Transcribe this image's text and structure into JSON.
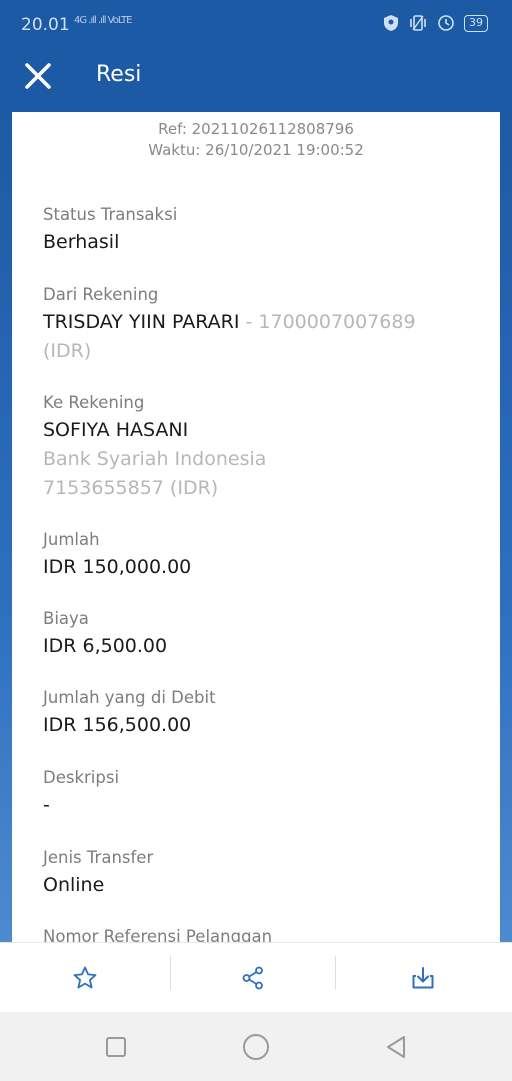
{
  "status_bar": {
    "time": "20.01",
    "signal_text": "4G .ıll .ıll VoLTE",
    "battery": "39",
    "icons": [
      "shield-icon",
      "vibrate-icon",
      "alarm-icon",
      "battery-icon"
    ]
  },
  "app_bar": {
    "title": "Resi",
    "close_icon": "close-icon"
  },
  "receipt": {
    "ref": "Ref: 20211026112808796",
    "time": "Waktu: 26/10/2021 19:00:52",
    "status": {
      "label": "Status Transaksi",
      "value": "Berhasil"
    },
    "from": {
      "label": "Dari Rekening",
      "name": "TRISDAY YIIN PARARI",
      "account_suffix": " - 1700007007689",
      "currency": "(IDR)"
    },
    "to": {
      "label": "Ke Rekening",
      "name": "SOFIYA HASANI",
      "bank": "Bank Syariah Indonesia",
      "account": "7153655857 (IDR)"
    },
    "amount": {
      "label": "Jumlah",
      "value": "IDR 150,000.00"
    },
    "fee": {
      "label": "Biaya",
      "value": "IDR 6,500.00"
    },
    "debit": {
      "label": "Jumlah yang di Debit",
      "value": "IDR 156,500.00"
    },
    "description": {
      "label": "Deskripsi",
      "value": "-"
    },
    "transfer_type": {
      "label": "Jenis Transfer",
      "value": "Online"
    },
    "customer_ref": {
      "label": "Nomor Referensi Pelanggan"
    }
  },
  "actions": {
    "icons": [
      "star-icon",
      "share-icon",
      "download-icon"
    ]
  },
  "colors": {
    "primary": "#1c5aa6",
    "action_icon": "#2f6fbe",
    "muted_text": "#b7b7b7"
  }
}
